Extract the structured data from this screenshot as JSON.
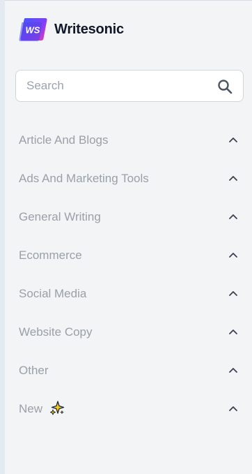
{
  "app": {
    "brand_name": "Writesonic",
    "logo_text": "WS"
  },
  "search": {
    "placeholder": "Search",
    "value": ""
  },
  "categories": [
    {
      "label": "Article And Blogs",
      "expanded": true
    },
    {
      "label": "Ads And Marketing Tools",
      "expanded": true
    },
    {
      "label": "General Writing",
      "expanded": true
    },
    {
      "label": "Ecommerce",
      "expanded": true
    },
    {
      "label": "Social Media",
      "expanded": true
    },
    {
      "label": "Website Copy",
      "expanded": true
    },
    {
      "label": "Other",
      "expanded": true
    },
    {
      "label": "New",
      "expanded": true,
      "icon": "sparkle-icon"
    }
  ],
  "colors": {
    "background": "#f3f4f6",
    "category_text": "#9aa0a8",
    "brand_text": "#111827",
    "logo_gradient_start": "#3b5bfd",
    "logo_gradient_end": "#e93bb2"
  }
}
